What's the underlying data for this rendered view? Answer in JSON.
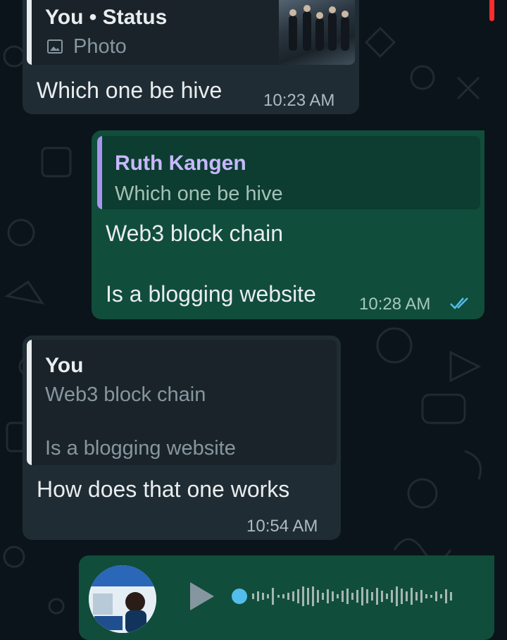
{
  "messages": [
    {
      "quote_name": "You • Status",
      "quote_text": "Photo",
      "text": "Which one be hive",
      "time": "10:23 AM"
    },
    {
      "quote_name": "Ruth Kangen",
      "quote_text": "Which one be hive",
      "text_line1": "Web3 block chain",
      "text_line2": "Is a blogging website",
      "time": "10:28 AM"
    },
    {
      "quote_name": "You",
      "quote_text_line1": "Web3 block chain",
      "quote_text_line2": "Is a blogging website",
      "text": "How does that one works",
      "time": "10:54 AM"
    }
  ],
  "icons": {
    "photo": "image-icon",
    "read_receipt": "double-check-icon",
    "play": "play-icon"
  },
  "colors": {
    "background": "#0b141a",
    "incoming_bubble": "#202c33",
    "outgoing_bubble": "#114d3b",
    "quote_name_purple": "#c7b8ff",
    "read_check_blue": "#53bdeb"
  }
}
